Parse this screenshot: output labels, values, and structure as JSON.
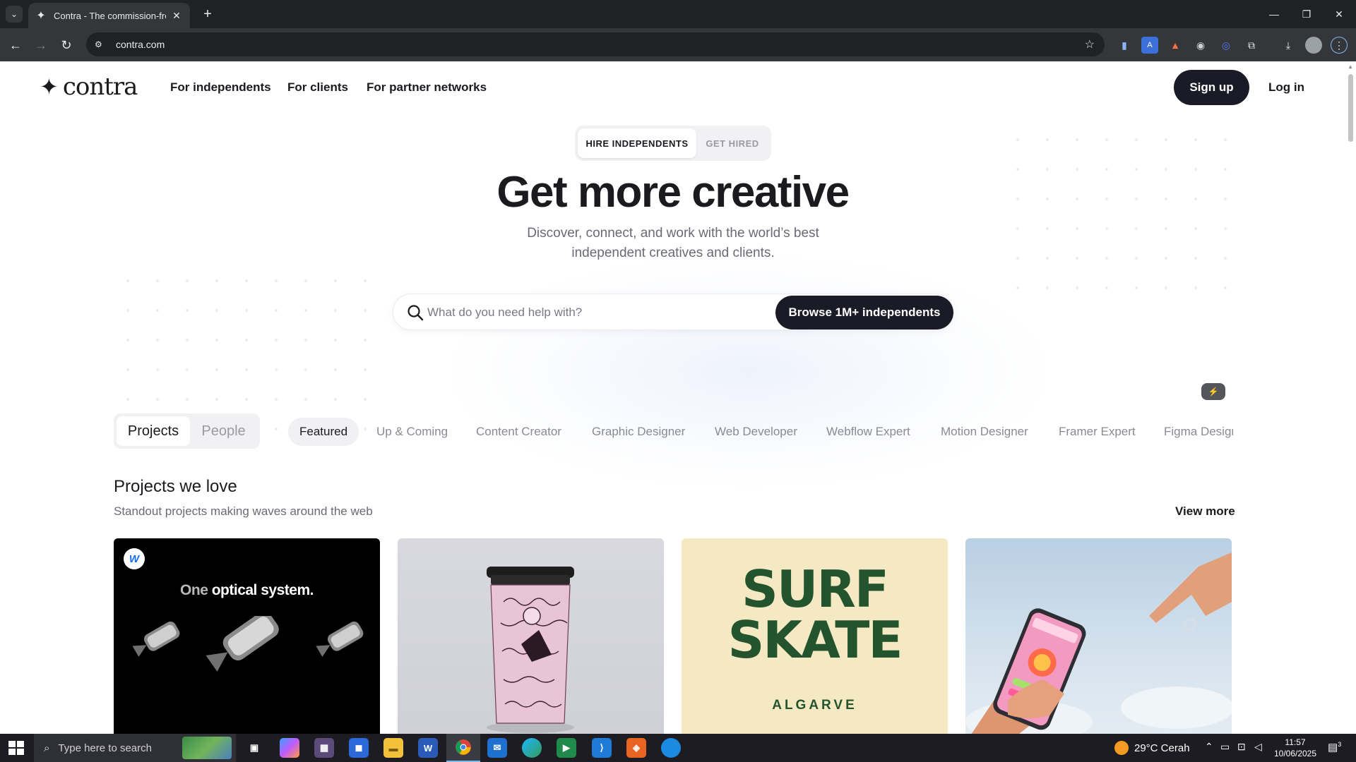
{
  "browser": {
    "tab_title": "Contra - The commission-free f",
    "tab_close": "✕",
    "new_tab": "+",
    "url": "contra.com",
    "window_controls": {
      "minimize": "—",
      "restore": "❐",
      "close": "✕"
    }
  },
  "nav": {
    "logo_text": "contra",
    "links": [
      "For independents",
      "For clients",
      "For partner networks"
    ],
    "signup": "Sign up",
    "login": "Log in"
  },
  "hero": {
    "segment": {
      "active": "HIRE INDEPENDENTS",
      "inactive": "GET HIRED"
    },
    "title": "Get more creative",
    "subtitle": "Discover, connect, and work with the world’s best independent creatives and clients.",
    "search_placeholder": "What do you need help with?",
    "browse_button": "Browse 1M+ independents"
  },
  "filters": {
    "toggle": {
      "active": "Projects",
      "inactive": "People"
    },
    "categories": [
      "Featured",
      "Up & Coming",
      "Content Creator",
      "Graphic Designer",
      "Web Developer",
      "Webflow Expert",
      "Motion Designer",
      "Framer Expert",
      "Figma Designer"
    ]
  },
  "section": {
    "title": "Projects we love",
    "subtitle": "Standout projects making waves around the web",
    "view_more": "View more"
  },
  "cards": {
    "card1": {
      "badge": "W",
      "text_dim": "One",
      "text_main": "optical system."
    },
    "card3": {
      "line1": "SURF",
      "line2": "SKATE",
      "line3": "ALGARVE"
    }
  },
  "taskbar": {
    "search_text": "Type here to search",
    "weather": "29°C  Cerah",
    "time": "11:57",
    "date": "10/06/2025",
    "notif_count": "3"
  },
  "colors": {
    "brand_dark": "#1b1b28",
    "surf_green": "#24542e",
    "card3_bg": "#f4e9c3",
    "webflow_blue": "#146ef5"
  },
  "icons": [
    "chevron-down-icon",
    "contra-favicon",
    "close-icon",
    "plus-icon",
    "back-icon",
    "forward-icon",
    "reload-icon",
    "site-info-icon",
    "star-icon",
    "extensions-icon",
    "download-icon",
    "profile-icon",
    "menu-icon",
    "search-icon",
    "magic-icon",
    "windows-icon",
    "weather-icon"
  ]
}
